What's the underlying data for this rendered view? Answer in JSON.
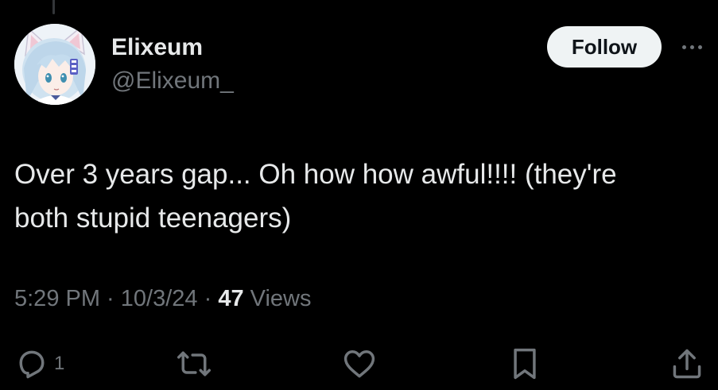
{
  "author": {
    "display_name": "Elixeum",
    "handle": "@Elixeum_"
  },
  "follow_label": "Follow",
  "tweet": {
    "text": "Over 3 years gap... Oh how how awful!!!! (they're\nboth stupid teenagers)"
  },
  "meta": {
    "time": "5:29 PM",
    "separator": " · ",
    "date": "10/3/24",
    "views_count": "47",
    "views_label": " Views"
  },
  "actions": {
    "reply_count": "1",
    "icons": [
      "reply-icon",
      "retweet-icon",
      "like-icon",
      "bookmark-icon",
      "share-icon"
    ]
  },
  "colors": {
    "background": "#000000",
    "primary_text": "#e7e9ea",
    "secondary_text": "#71767b",
    "follow_bg": "#eff3f4"
  }
}
